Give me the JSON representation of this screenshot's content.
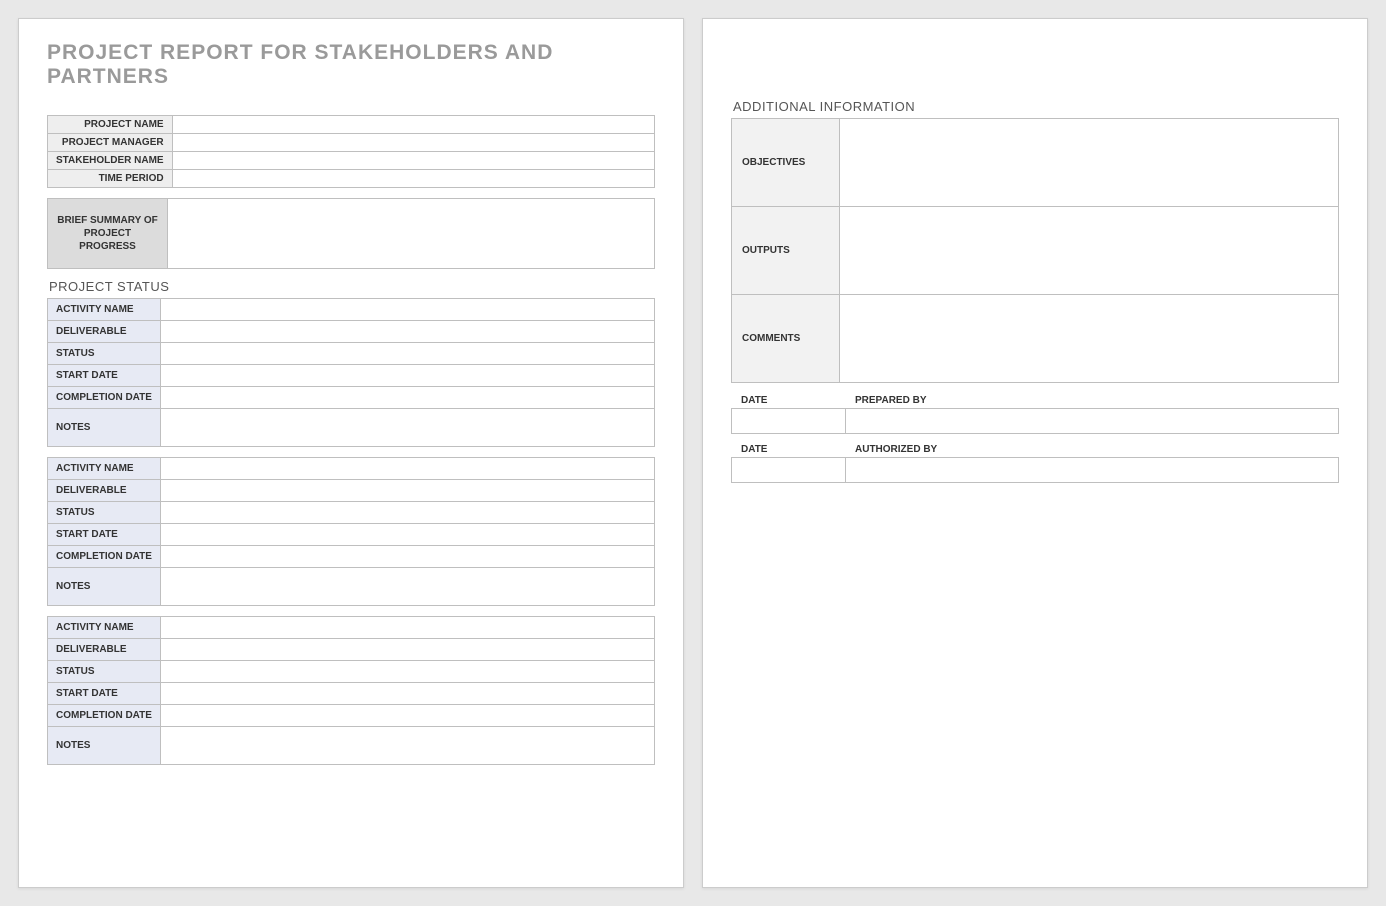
{
  "title": "PROJECT REPORT FOR STAKEHOLDERS AND PARTNERS",
  "header_fields": {
    "project_name": {
      "label": "PROJECT NAME",
      "value": ""
    },
    "project_manager": {
      "label": "PROJECT MANAGER",
      "value": ""
    },
    "stakeholder_name": {
      "label": "STAKEHOLDER NAME",
      "value": ""
    },
    "time_period": {
      "label": "TIME PERIOD",
      "value": ""
    }
  },
  "summary": {
    "label": "BRIEF SUMMARY OF PROJECT PROGRESS",
    "value": ""
  },
  "project_status_heading": "PROJECT STATUS",
  "activity_labels": {
    "activity_name": "ACTIVITY NAME",
    "deliverable": "DELIVERABLE",
    "status": "STATUS",
    "start_date": "START DATE",
    "completion_date": "COMPLETION DATE",
    "notes": "NOTES"
  },
  "activities": [
    {
      "activity_name": "",
      "deliverable": "",
      "status": "",
      "start_date": "",
      "completion_date": "",
      "notes": ""
    },
    {
      "activity_name": "",
      "deliverable": "",
      "status": "",
      "start_date": "",
      "completion_date": "",
      "notes": ""
    },
    {
      "activity_name": "",
      "deliverable": "",
      "status": "",
      "start_date": "",
      "completion_date": "",
      "notes": ""
    }
  ],
  "additional_info_heading": "ADDITIONAL INFORMATION",
  "additional_info": {
    "objectives": {
      "label": "OBJECTIVES",
      "value": ""
    },
    "outputs": {
      "label": "OUTPUTS",
      "value": ""
    },
    "comments": {
      "label": "COMMENTS",
      "value": ""
    }
  },
  "signoff": {
    "prepared": {
      "date_label": "DATE",
      "by_label": "PREPARED BY",
      "date": "",
      "by": ""
    },
    "authorized": {
      "date_label": "DATE",
      "by_label": "AUTHORIZED BY",
      "date": "",
      "by": ""
    }
  }
}
